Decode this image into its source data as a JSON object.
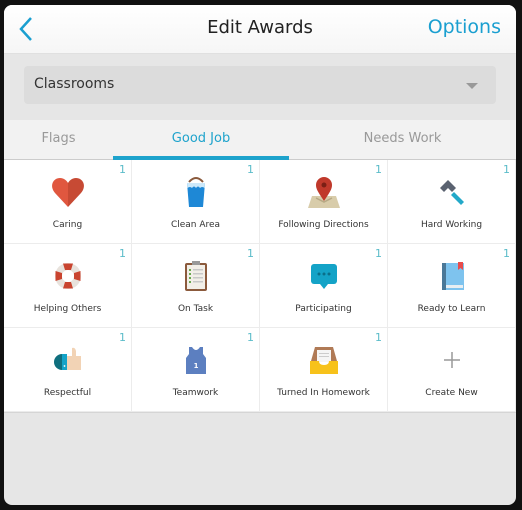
{
  "nav": {
    "back_icon": "chevron-left-icon",
    "title": "Edit Awards",
    "options_label": "Options"
  },
  "filter": {
    "selected": "Classrooms",
    "icon": "dropdown-caret-icon"
  },
  "tabs": [
    {
      "label": "Flags",
      "active": false
    },
    {
      "label": "Good Job",
      "active": true
    },
    {
      "label": "Needs Work",
      "active": false
    }
  ],
  "awards": [
    {
      "label": "Caring",
      "count": "1",
      "icon": "heart-icon"
    },
    {
      "label": "Clean Area",
      "count": "1",
      "icon": "bucket-icon"
    },
    {
      "label": "Following Directions",
      "count": "1",
      "icon": "map-pin-icon"
    },
    {
      "label": "Hard Working",
      "count": "1",
      "icon": "hammer-icon"
    },
    {
      "label": "Helping Others",
      "count": "1",
      "icon": "lifebuoy-icon"
    },
    {
      "label": "On Task",
      "count": "1",
      "icon": "clipboard-icon"
    },
    {
      "label": "Participating",
      "count": "1",
      "icon": "speech-bubble-icon"
    },
    {
      "label": "Ready to Learn",
      "count": "1",
      "icon": "book-icon"
    },
    {
      "label": "Respectful",
      "count": "1",
      "icon": "thumbs-up-icon"
    },
    {
      "label": "Teamwork",
      "count": "1",
      "icon": "jersey-icon"
    },
    {
      "label": "Turned In Homework",
      "count": "1",
      "icon": "inbox-tray-icon"
    },
    {
      "label": "Create New",
      "count": null,
      "icon": "plus-icon"
    }
  ],
  "colors": {
    "accent": "#1ea3cc",
    "count": "#5bbcc9"
  }
}
